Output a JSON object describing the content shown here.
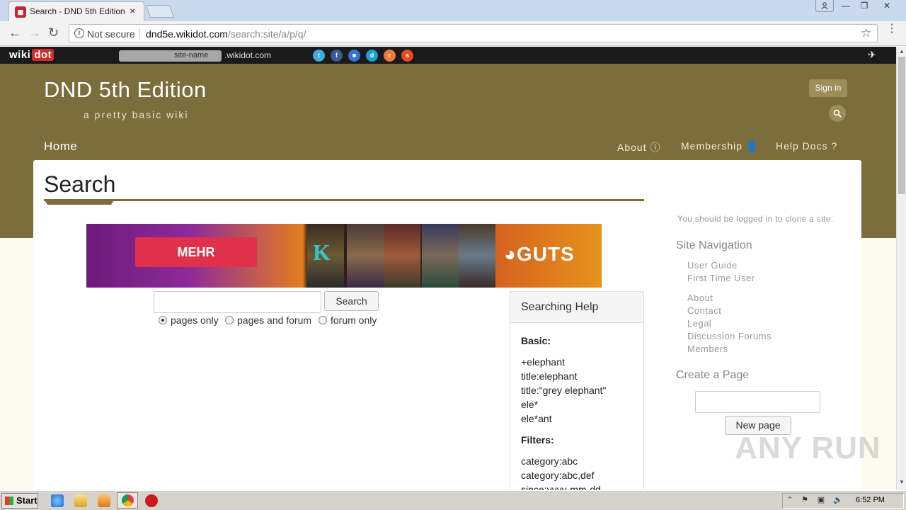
{
  "browser": {
    "tab_title": "Search - DND 5th Edition",
    "tab_close": "×",
    "not_secure": "Not secure",
    "url_host": "dnd5e.wikidot.com",
    "url_path": "/search:site/a/p/q/"
  },
  "wikidot_bar": {
    "logo_left": "wiki",
    "logo_right": "dot",
    "site_name_placeholder": "site-name",
    "site_suffix": ".wikidot.com",
    "social_icons": [
      "twitter-icon",
      "facebook-icon",
      "delicious-icon",
      "digg-icon",
      "reddit-icon",
      "stumbleupon-icon"
    ]
  },
  "site": {
    "title": "DND 5th Edition",
    "subtitle": "a pretty basic wiki",
    "signin": "Sign in",
    "nav": {
      "home": "Home",
      "about": "About",
      "membership": "Membership",
      "help_docs": "Help Docs"
    }
  },
  "main": {
    "page_title": "Search",
    "ad": {
      "button": "MEHR",
      "brand": "GUTS",
      "symbol": "K"
    },
    "search": {
      "button": "Search",
      "value": "",
      "options": [
        "pages only",
        "pages and forum",
        "forum only"
      ],
      "selected": "pages only"
    },
    "help": {
      "title": "Searching Help",
      "basic_heading": "Basic:",
      "basic_lines": [
        "+elephant",
        "title:elephant",
        "title:\"grey elephant\"",
        "ele*",
        "ele*ant"
      ],
      "filters_heading": "Filters:",
      "filter_lines": [
        "category:abc",
        "category:abc,def",
        "since:yyyy-mm-dd"
      ]
    }
  },
  "sidebar": {
    "clone_note": "You should be logged in to clone a site.",
    "nav_heading": "Site Navigation",
    "links_group1": [
      "User Guide",
      "First Time User"
    ],
    "links_group2": [
      "About",
      "Contact",
      "Legal",
      "Discussion Forums",
      "Members"
    ],
    "create_heading": "Create a Page",
    "new_page_button": "New page"
  },
  "watermark": "ANY RUN",
  "taskbar": {
    "start": "Start",
    "clock": "6:52 PM"
  },
  "colors": {
    "header_bg": "#7b6e3c",
    "wikidot_red": "#d12c2c",
    "page_bg": "#fdfaf0"
  }
}
